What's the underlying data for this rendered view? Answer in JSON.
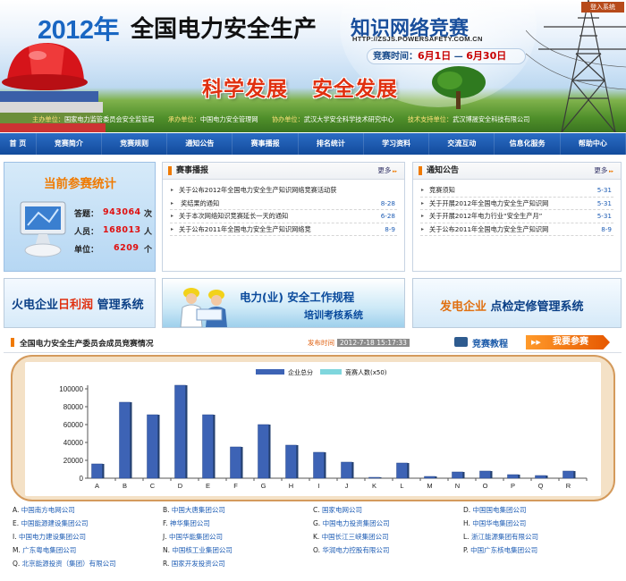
{
  "header": {
    "login": "登入系统",
    "title_year": "2012年",
    "title_main": "全国电力安全生产",
    "title_sub": "知识网络竞赛",
    "url": "HTTP://ZSJS.POWERSAFETY.COM.CN",
    "contest_time_label": "竞赛时间：",
    "contest_start": "6月1日",
    "contest_sep": "—",
    "contest_end": "6月30日",
    "slogan": "科学发展   安全发展",
    "sponsors": [
      {
        "role": "主办单位：",
        "name": "国家电力监管委员会安全监管局"
      },
      {
        "role": "承办单位：",
        "name": "中国电力安全管理网"
      },
      {
        "role": "协办单位：",
        "name": "武汉大学安全科学技术研究中心"
      },
      {
        "role": "技术支持单位：",
        "name": "武汉博晟安全科技有限公司"
      }
    ]
  },
  "nav": [
    "首 页",
    "竞赛简介",
    "竞赛规则",
    "通知公告",
    "赛事播报",
    "排名统计",
    "学习资料",
    "交流互动",
    "信息化服务",
    "帮助中心"
  ],
  "stats": {
    "title": "当前参赛统计",
    "rows": [
      {
        "label": "答题：",
        "value": "943064",
        "unit": "次"
      },
      {
        "label": "人员：",
        "value": "168013",
        "unit": "人"
      },
      {
        "label": "单位：",
        "value": "6209",
        "unit": "个"
      }
    ]
  },
  "news": {
    "title": "赛事播报",
    "more": "更多",
    "items": [
      {
        "text": "关于公布2012年全国电力安全生产知识网络竞赛活动获",
        "date": ""
      },
      {
        "text": "奖结果的通知",
        "date": "8-28"
      },
      {
        "text": "关于本次网络知识竞赛延长一天的通知",
        "date": "6-28"
      },
      {
        "text": "关于公布2011年全国电力安全生产知识网络竞",
        "date": "8-9"
      }
    ]
  },
  "notice": {
    "title": "通知公告",
    "more": "更多",
    "items": [
      {
        "text": "竞赛须知",
        "date": "5-31"
      },
      {
        "text": "关于开展2012年全国电力安全生产知识网",
        "date": "5-31"
      },
      {
        "text": "关于开展2012年电力行业“安全生产月”",
        "date": "5-31"
      },
      {
        "text": "关于公布2011年全国电力安全生产知识网",
        "date": "8-9"
      }
    ]
  },
  "banners": {
    "b1_pre": "火电企业",
    "b1_hl": "日利润",
    "b1_post": "管理系统",
    "b2_main": "电力(业) 安全工作规程",
    "b2_sub": "培训考核系统",
    "b3_hl": "发电企业",
    "b3_post": " 点检定修管理系统"
  },
  "section": {
    "title": "全国电力安全生产委员会成员竞赛情况",
    "pub_label": "发布时间",
    "pub_time": "2012-7-18 15:17:33",
    "tutorial": "竞赛教程",
    "join": "我要参赛"
  },
  "chart_data": {
    "type": "bar",
    "categories": [
      "A",
      "B",
      "C",
      "D",
      "E",
      "F",
      "G",
      "H",
      "I",
      "J",
      "K",
      "L",
      "M",
      "N",
      "O",
      "P",
      "Q",
      "R"
    ],
    "series": [
      {
        "name": "企业总分",
        "values": [
          16000,
          85000,
          71000,
          104000,
          71000,
          35000,
          60000,
          37000,
          29000,
          18000,
          1000,
          17000,
          2000,
          7000,
          8000,
          4000,
          3000,
          8000
        ],
        "color": "#3d63b5"
      },
      {
        "name": "竞赛人数(x50)",
        "values": [
          0,
          0,
          0,
          0,
          0,
          0,
          0,
          0,
          0,
          0,
          0,
          0,
          0,
          0,
          0,
          0,
          0,
          0
        ],
        "color": "#7fd6dd"
      }
    ],
    "ylim": [
      0,
      100000
    ],
    "yticks": [
      0,
      20000,
      40000,
      60000,
      80000,
      100000
    ],
    "ytick_labels": [
      "0",
      "20000",
      "40000",
      "60000",
      "80000",
      "100000"
    ],
    "legend": "top-center",
    "grid": false
  },
  "companies": [
    {
      "code": "A.",
      "name": "中国南方电网公司"
    },
    {
      "code": "B.",
      "name": "中国大唐集团公司"
    },
    {
      "code": "C.",
      "name": "国家电网公司"
    },
    {
      "code": "D.",
      "name": "中国国电集团公司"
    },
    {
      "code": "E.",
      "name": "中国能源建设集团公司"
    },
    {
      "code": "F.",
      "name": "神华集团公司"
    },
    {
      "code": "G.",
      "name": "中国电力投资集团公司"
    },
    {
      "code": "H.",
      "name": "中国华电集团公司"
    },
    {
      "code": "I.",
      "name": "中国电力建设集团公司"
    },
    {
      "code": "J.",
      "name": "中国华能集团公司"
    },
    {
      "code": "K.",
      "name": "中国长江三峡集团公司"
    },
    {
      "code": "L.",
      "name": "浙江能源集团有限公司"
    },
    {
      "code": "M.",
      "name": "广东粤电集团公司"
    },
    {
      "code": "N.",
      "name": "中国核工业集团公司"
    },
    {
      "code": "O.",
      "name": "华润电力控股有限公司"
    },
    {
      "code": "P.",
      "name": "中国广东核电集团公司"
    },
    {
      "code": "Q.",
      "name": "北京能源投资（集团）有限公司"
    },
    {
      "code": "R.",
      "name": "国家开发投资公司"
    }
  ]
}
